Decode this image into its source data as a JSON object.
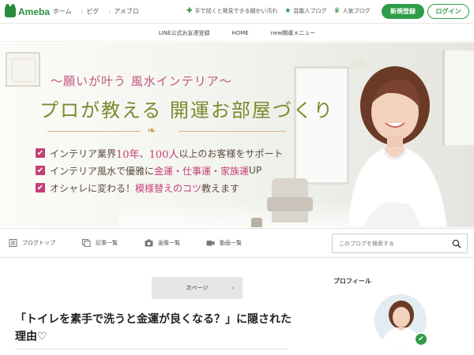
{
  "header": {
    "logo_text": "Ameba",
    "breadcrumbs": [
      "ホーム",
      "ピグ",
      "アメブロ"
    ],
    "links": [
      {
        "label": "手で拭くと発見できる細かい汚れ",
        "icon": "plus-icon"
      },
      {
        "label": "芸能人ブログ",
        "icon": "star-icon"
      },
      {
        "label": "人気ブログ",
        "icon": "crown-icon"
      }
    ],
    "register_label": "新規登録",
    "login_label": "ログイン"
  },
  "subnav": {
    "items": [
      "LINE公式お友達登録",
      "HOME",
      "new開運メニュー"
    ]
  },
  "hero": {
    "tagline": "〜願いが叶う 風水インテリア〜",
    "headline": "プロが教える 開運お部屋づくり",
    "ornament": "❧",
    "checks": [
      {
        "pre": "インテリア業界",
        "hl1": "10年",
        "mid": "、",
        "hl2": "100人",
        "post": "以上のお客様をサポート"
      },
      {
        "pre": "インテリア風水で優雅に",
        "hl1": "金運・仕事運・家族運",
        "mid": "",
        "hl2": "",
        "post": "UP"
      },
      {
        "pre": "オシャレに変わる！",
        "hl1": "模様替えのコツ",
        "mid": "",
        "hl2": "",
        "post": "教えます"
      }
    ]
  },
  "blognav": {
    "items": [
      "ブログトップ",
      "記事一覧",
      "画像一覧",
      "動画一覧"
    ],
    "search_placeholder": "このブログを検索する"
  },
  "content": {
    "next_page_label": "次ページ",
    "post_title": "「トイレを素手で洗うと金運が良くなる？」に隠された理由♡"
  },
  "sidebar": {
    "profile_title": "プロフィール"
  },
  "colors": {
    "brand_green": "#2e9c48",
    "accent_pink": "#c43f74",
    "headline_olive": "#7a8a2e"
  }
}
